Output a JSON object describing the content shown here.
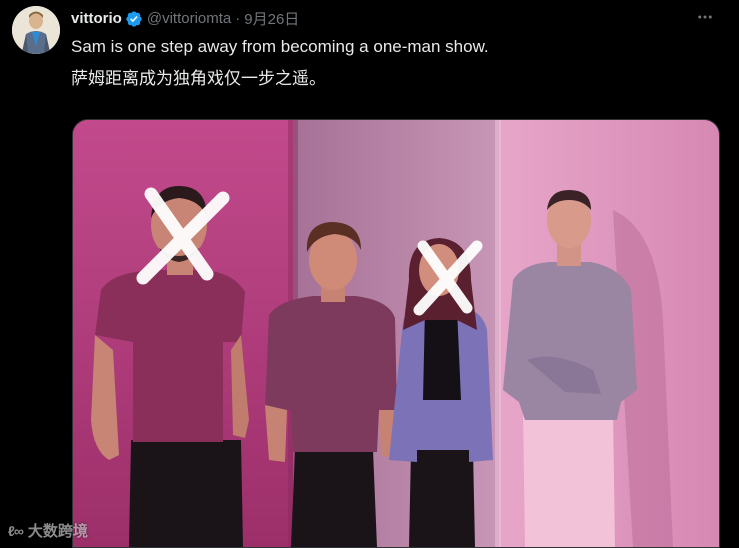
{
  "author": {
    "display_name": "vittorio",
    "handle": "@vittoriomta",
    "separator": "·",
    "date": "9月26日",
    "verified": true
  },
  "tweet": {
    "text_en": "Sam is one step away from becoming a one-man show.",
    "text_zh": "萨姆距离成为独角戏仅一步之遥。"
  },
  "media": {
    "description": "four-person-photo-with-two-faces-crossed-out"
  },
  "watermark": {
    "logo": "ℓ∞",
    "text": "大数跨境"
  },
  "icons": {
    "more": "more-horizontal-icon",
    "verified": "verified-badge-icon"
  },
  "colors": {
    "background": "#000000",
    "primary_text": "#e7e9ea",
    "secondary_text": "#71767b",
    "verified_blue": "#1d9bf0",
    "photo_magenta": "#b2407e"
  }
}
